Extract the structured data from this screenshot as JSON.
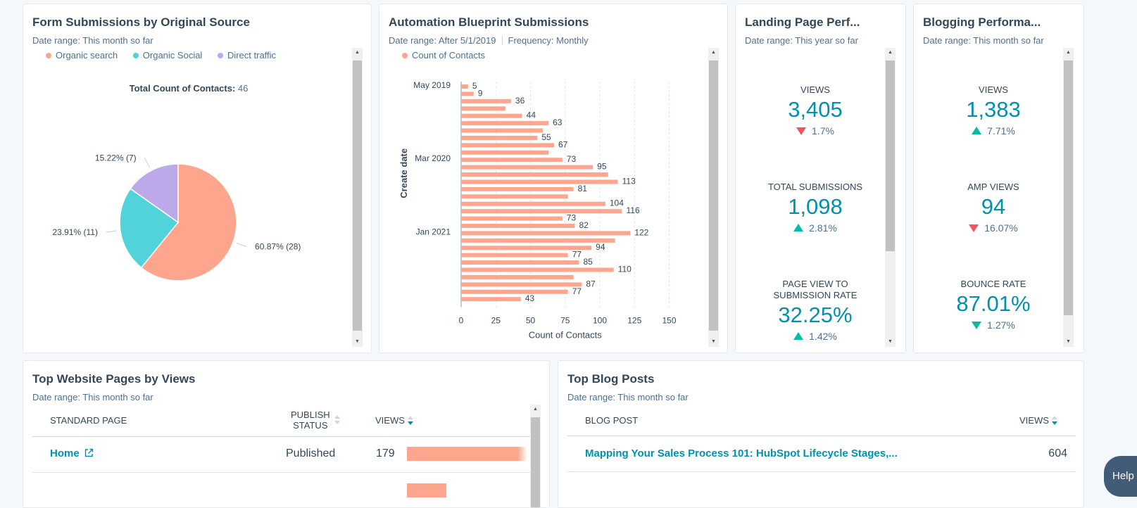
{
  "form_sources": {
    "title": "Form Submissions by Original Source",
    "date_range": "Date range: This month so far",
    "legend": [
      {
        "label": "Organic search",
        "color": "#ff8f59"
      },
      {
        "label": "Organic Social",
        "color": "#00bda5"
      },
      {
        "label": "Direct traffic",
        "color": "#6a78d1"
      }
    ],
    "total_label": "Total Count of Contacts:",
    "total_value": "46"
  },
  "automation": {
    "title": "Automation Blueprint Submissions",
    "date_range": "Date range: After 5/1/2019",
    "frequency": "Frequency: Monthly",
    "legend": "Count of Contacts"
  },
  "landing": {
    "title": "Landing Page Perf...",
    "date_range": "Date range: This year so far",
    "kpis": [
      {
        "label": "Views",
        "value": "3,405",
        "change": "1.7%",
        "direction": "down"
      },
      {
        "label": "Total Submissions",
        "value": "1,098",
        "change": "2.81%",
        "direction": "up"
      },
      {
        "label": "Page View to Submission Rate",
        "value": "32.25%",
        "change": "1.42%",
        "direction": "up"
      }
    ]
  },
  "blogging": {
    "title": "Blogging Performa...",
    "date_range": "Date range: This month so far",
    "kpis": [
      {
        "label": "Views",
        "value": "1,383",
        "change": "7.71%",
        "direction": "up"
      },
      {
        "label": "AMP Views",
        "value": "94",
        "change": "16.07%",
        "direction": "down"
      },
      {
        "label": "Bounce Rate",
        "value": "87.01%",
        "change": "1.27%",
        "direction": "down"
      }
    ]
  },
  "top_pages": {
    "title": "Top Website Pages by Views",
    "date_range": "Date range: This month so far",
    "col_page": "Standard Page",
    "col_status_1": "Publish",
    "col_status_2": "Status",
    "col_views": "Views",
    "rows": [
      {
        "page": "Home",
        "status": "Published",
        "views": "179",
        "bar_fraction": 0.97
      }
    ]
  },
  "top_blog": {
    "title": "Top Blog Posts",
    "date_range": "Date range: This month so far",
    "col_post": "Blog Post",
    "col_views": "Views",
    "rows": [
      {
        "post": "Mapping Your Sales Process 101: HubSpot Lifecycle Stages,...",
        "views": "604"
      }
    ]
  },
  "help": "Help",
  "chart_data": [
    {
      "type": "pie",
      "labels": [
        "Organic search",
        "Organic Social",
        "Direct traffic"
      ],
      "values": [
        28,
        11,
        7
      ],
      "slice_labels": [
        "60.87% (28)",
        "23.91% (11)",
        "15.22% (7)"
      ],
      "colors": [
        "#fea58e",
        "#51d3d9",
        "#bda9ea"
      ]
    },
    {
      "type": "bar",
      "orientation": "horizontal",
      "ylabel": "Create date",
      "xlabel": "Count of Contacts",
      "y_tick_labels": [
        "May 2019",
        "Mar 2020",
        "Jan 2021"
      ],
      "x_ticks": [
        0,
        25,
        50,
        75,
        100,
        125,
        150
      ],
      "xlim": [
        0,
        150
      ],
      "values": [
        5,
        9,
        36,
        32,
        44,
        63,
        59,
        55,
        67,
        63,
        73,
        95,
        106,
        113,
        81,
        77,
        104,
        116,
        73,
        82,
        122,
        111,
        94,
        77,
        85,
        110,
        81,
        87,
        77,
        43
      ],
      "labeled": [
        5,
        9,
        36,
        44,
        63,
        55,
        67,
        73,
        95,
        113,
        81,
        104,
        116,
        73,
        82,
        122,
        94,
        77,
        85,
        110,
        87,
        77,
        43
      ],
      "color": "#fea58e"
    }
  ]
}
